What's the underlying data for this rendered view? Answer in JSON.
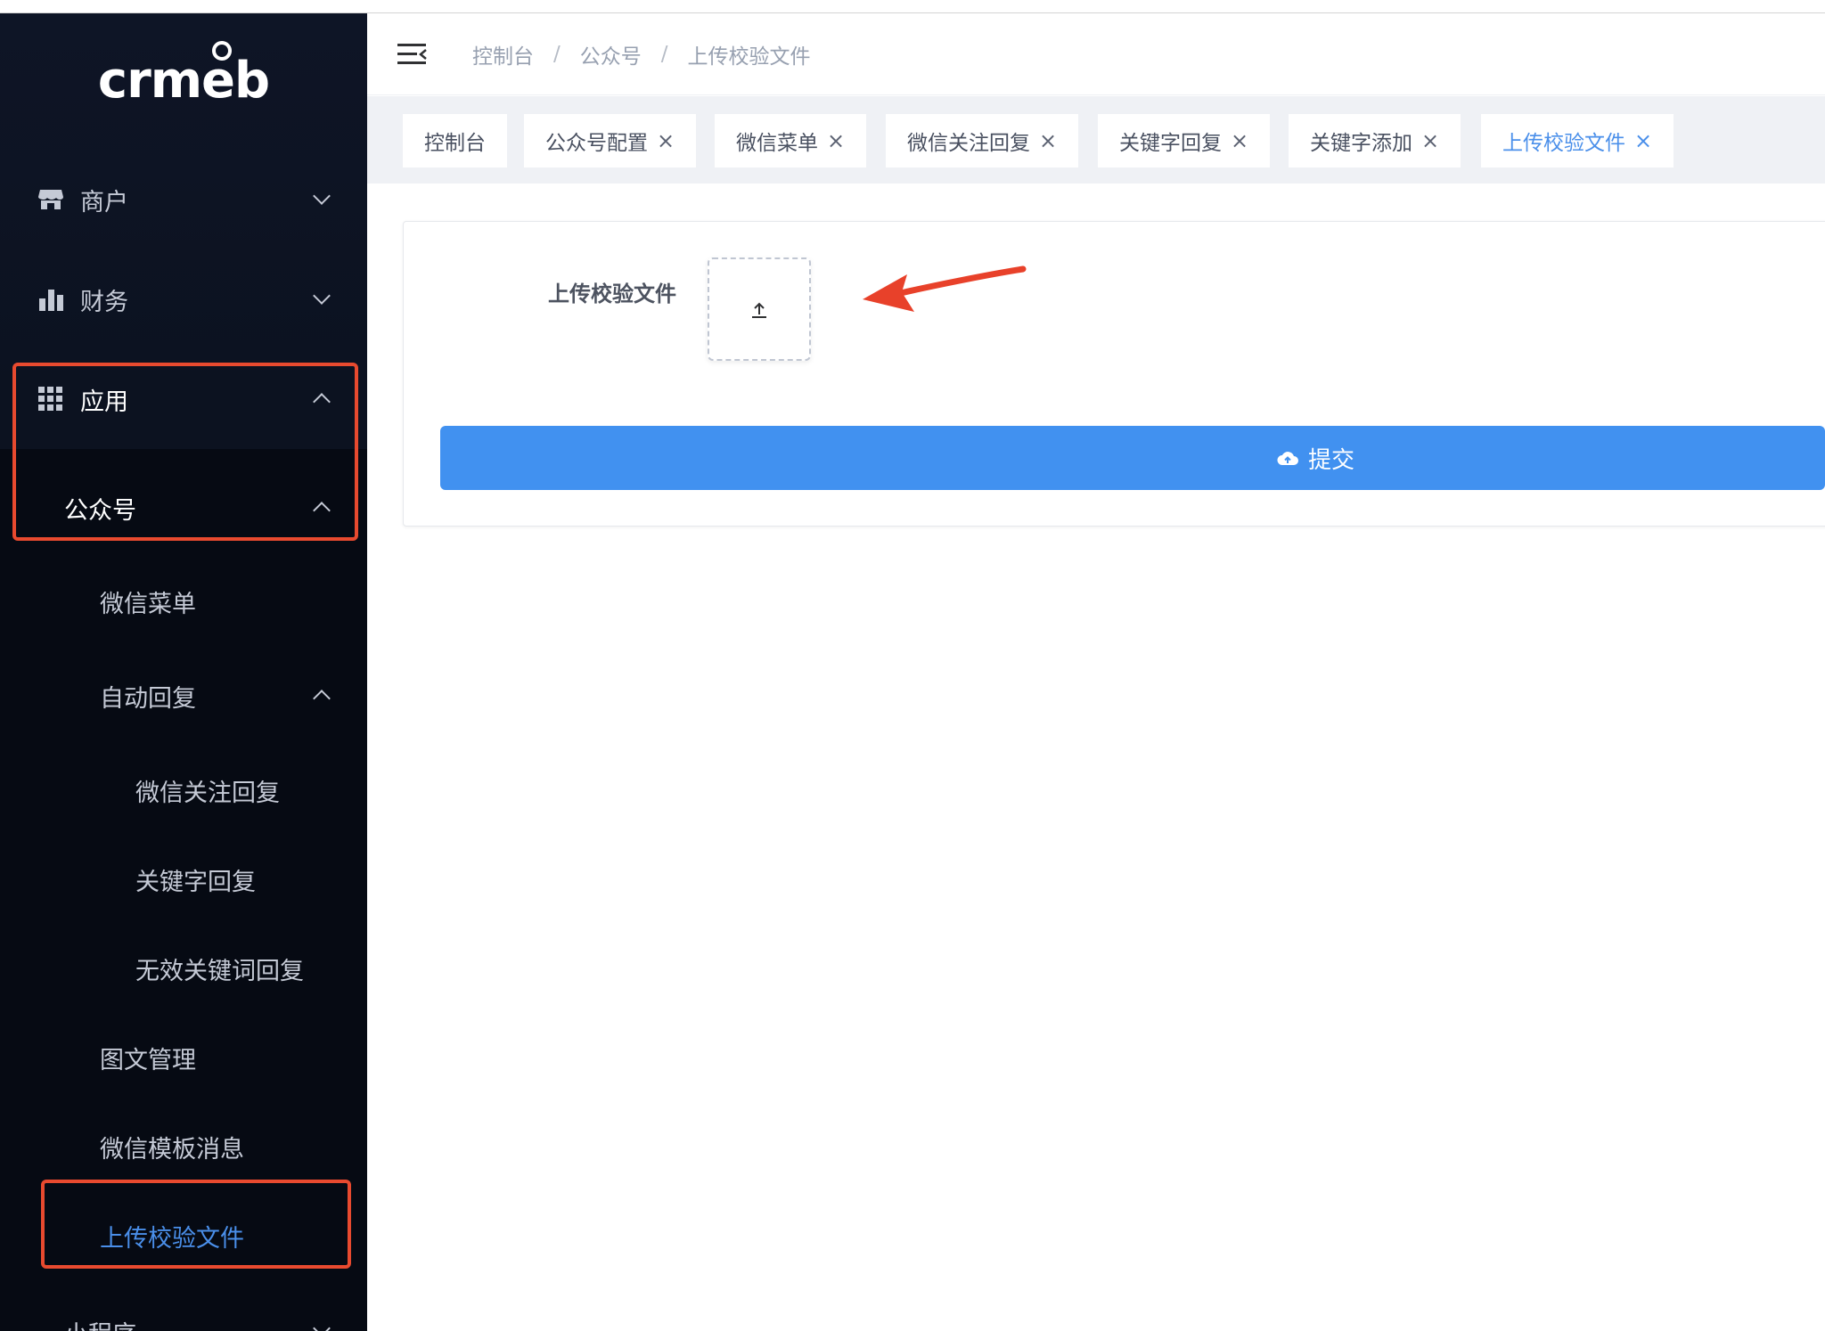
{
  "logo": {
    "text_pre": "crm",
    "text_o": "e",
    "text_post": "b"
  },
  "sidebar": {
    "items": [
      {
        "label": "商户",
        "icon": "shop-icon",
        "expanded": false
      },
      {
        "label": "财务",
        "icon": "bar-chart-icon",
        "expanded": false
      },
      {
        "label": "应用",
        "icon": "grid-icon",
        "expanded": true
      }
    ],
    "sub": {
      "gongzhonghao": "公众号",
      "weixin_menu": "微信菜单",
      "auto_reply": "自动回复",
      "follow_reply": "微信关注回复",
      "keyword_reply": "关键字回复",
      "invalid_keyword_reply": "无效关键词回复",
      "article_manage": "图文管理",
      "template_msg": "微信模板消息",
      "upload_verify": "上传校验文件",
      "mini_program": "小程序"
    }
  },
  "header": {
    "breadcrumb": [
      "控制台",
      "公众号",
      "上传校验文件"
    ],
    "separator": "/"
  },
  "tags": [
    {
      "label": "控制台",
      "closable": false,
      "active": false
    },
    {
      "label": "公众号配置",
      "closable": true,
      "active": false
    },
    {
      "label": "微信菜单",
      "closable": true,
      "active": false
    },
    {
      "label": "微信关注回复",
      "closable": true,
      "active": false
    },
    {
      "label": "关键字回复",
      "closable": true,
      "active": false
    },
    {
      "label": "关键字添加",
      "closable": true,
      "active": false
    },
    {
      "label": "上传校验文件",
      "closable": true,
      "active": true
    }
  ],
  "tag_close": "×",
  "form": {
    "label": "上传校验文件",
    "submit": "提交"
  },
  "colors": {
    "sidebar_bg": "#0c1220",
    "accent": "#4191f0",
    "active_text": "#4a8fea",
    "highlight_box": "#e84a2f",
    "annotation_arrow": "#e8412a"
  }
}
